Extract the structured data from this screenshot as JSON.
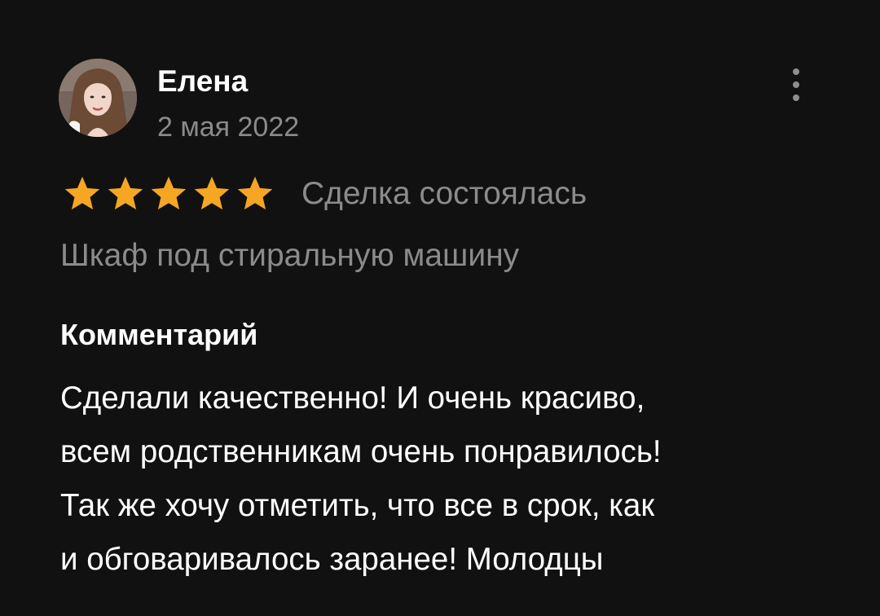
{
  "review": {
    "author": {
      "name": "Елена",
      "date": "2 мая 2022",
      "avatar_icon": "user-photo-avatar"
    },
    "menu_icon": "more-vertical-icon",
    "rating": {
      "value": 5,
      "max": 5,
      "star_color": "#f5a623",
      "star_icon": "star-icon"
    },
    "deal_status": "Сделка состоялась",
    "item_title": "Шкаф под стиральную машину",
    "comment": {
      "heading": "Комментарий",
      "lines": [
        "Сделали качественно! И очень красиво,",
        "всем родственникам очень понравилось!",
        "Так же хочу отметить, что все в срок, как",
        "и обговаривалось заранее! Молодцы"
      ]
    }
  },
  "colors": {
    "background": "#111111",
    "primary_text": "#ffffff",
    "secondary_text": "#8b8b8b",
    "accent_star": "#f5a623"
  }
}
